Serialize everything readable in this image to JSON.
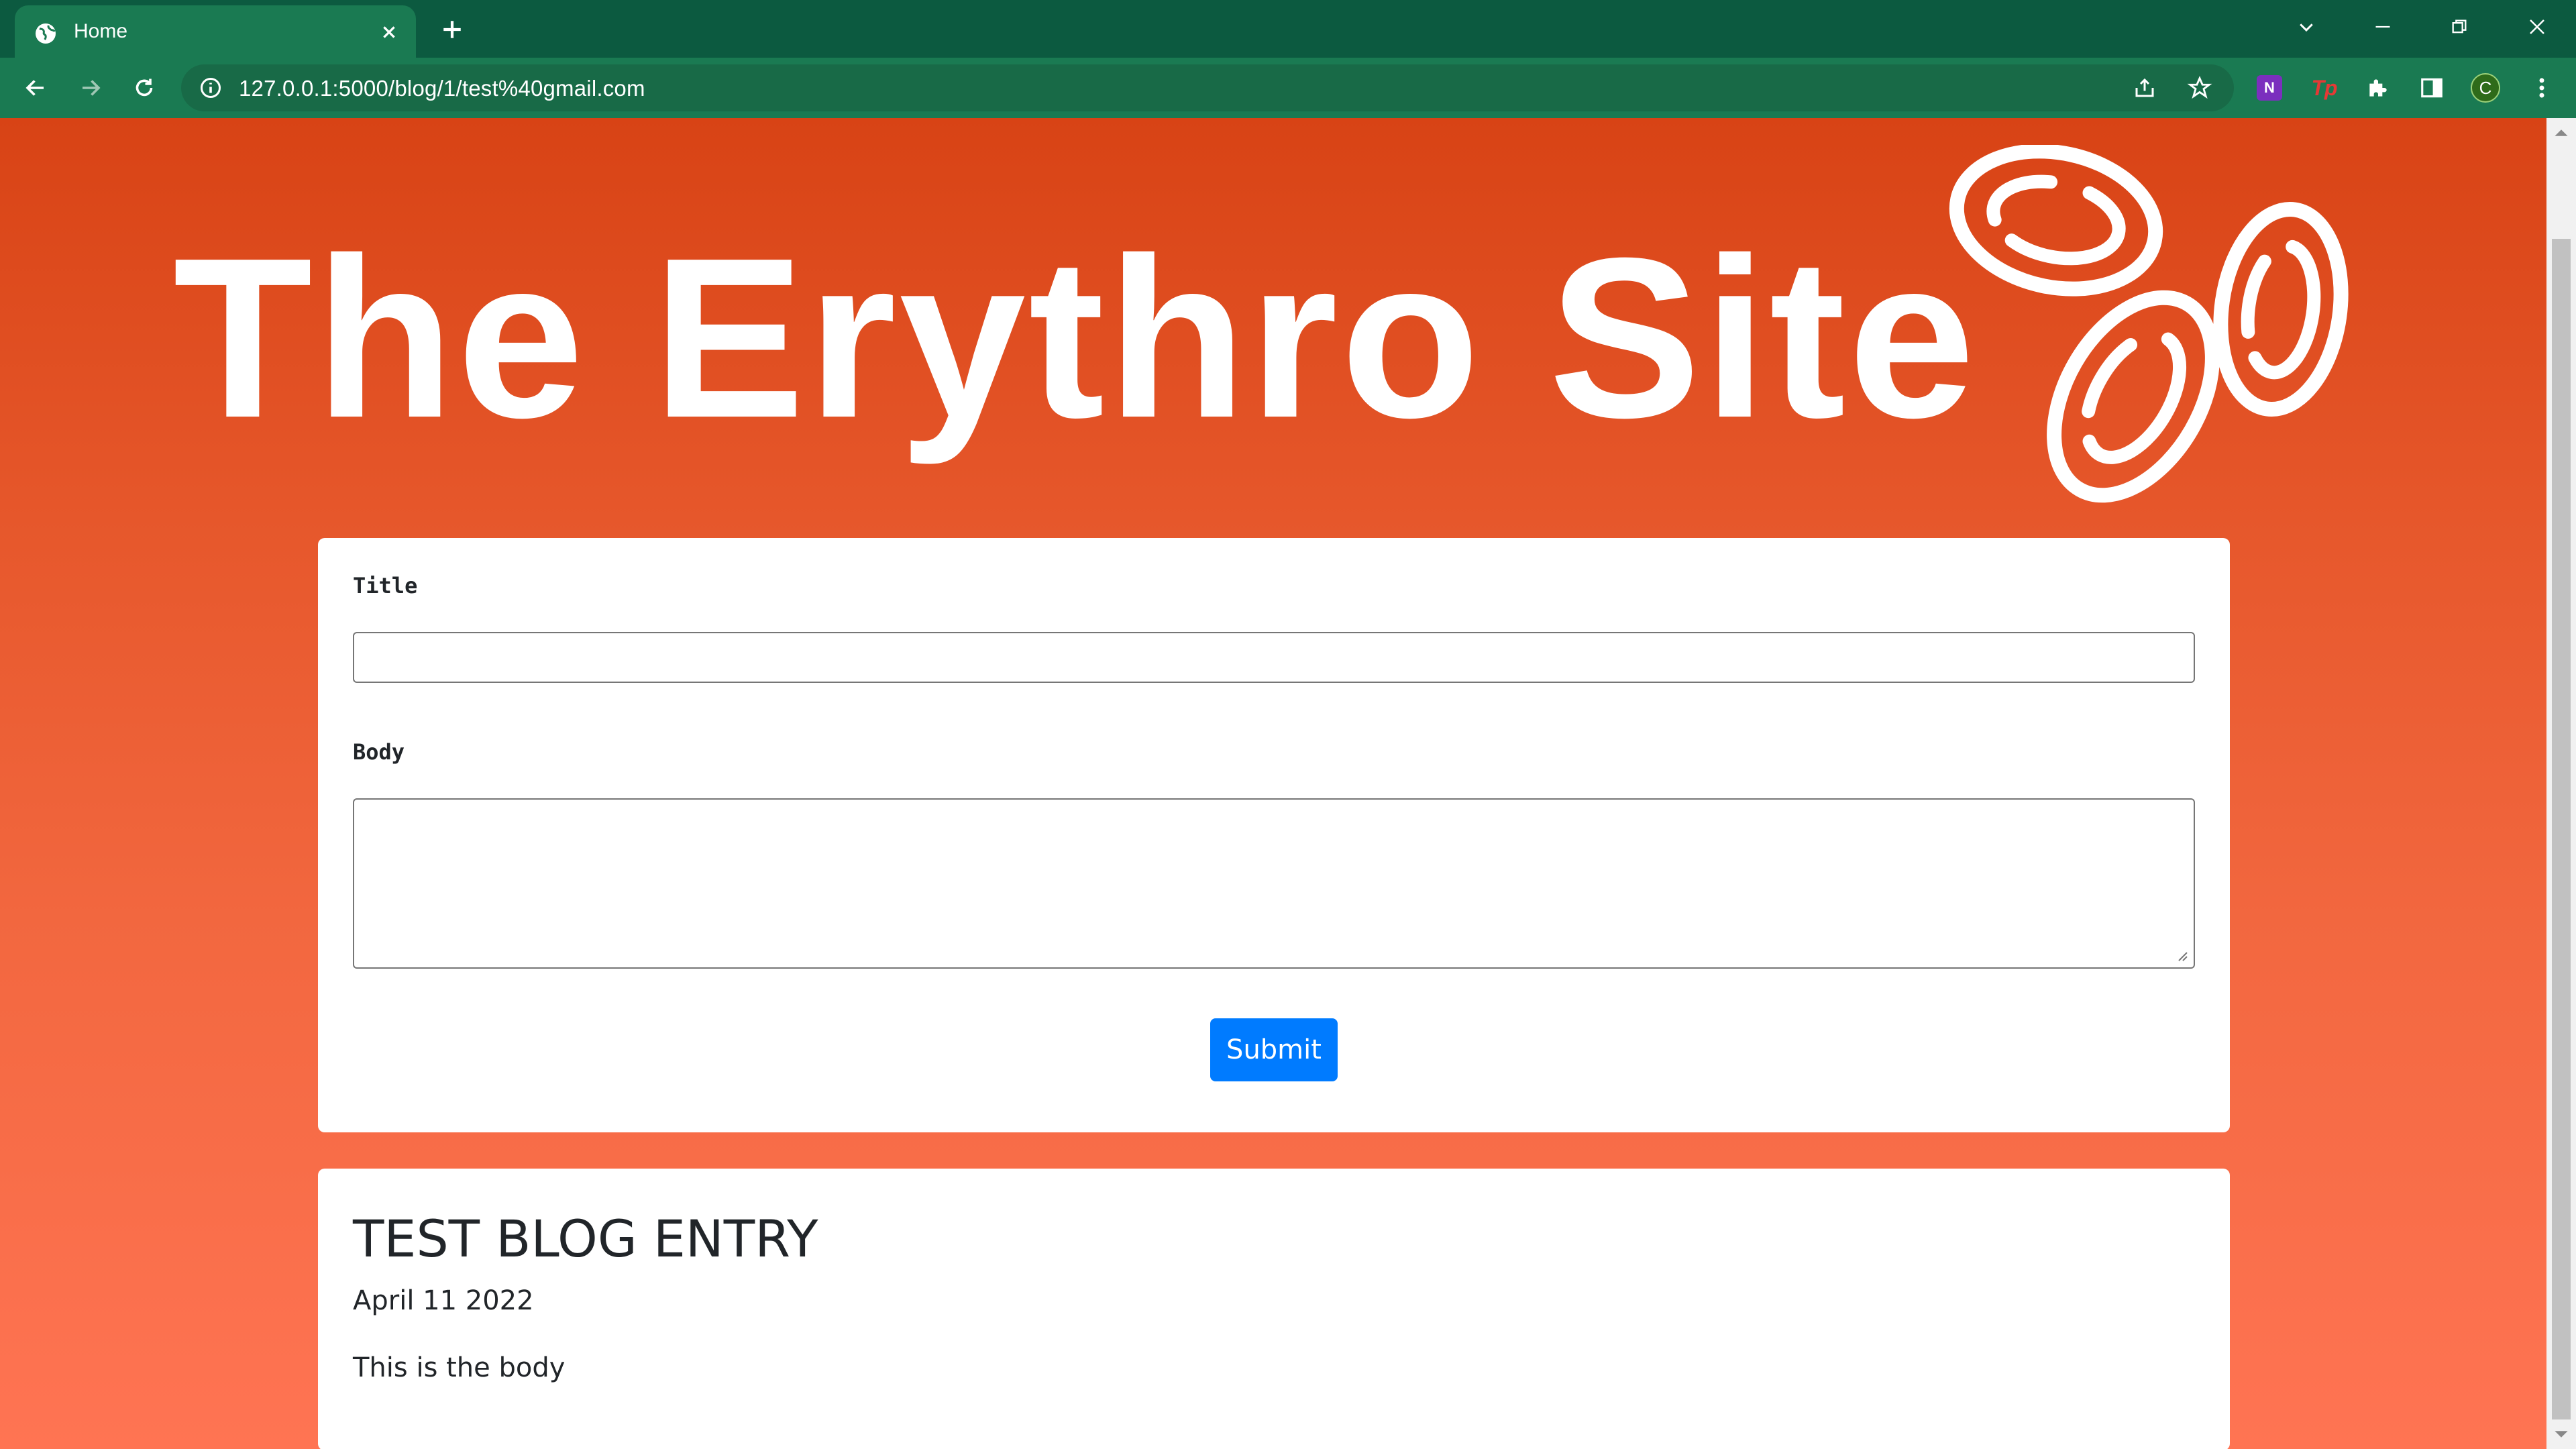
{
  "browser": {
    "tab_title": "Home",
    "url": "127.0.0.1:5000/blog/1/test%40gmail.com",
    "profile_initial": "C",
    "colors": {
      "frame": "#0c5a40",
      "toolbar": "#1a7a52"
    }
  },
  "page": {
    "site_title": "The Erythro Site",
    "logo_icon": "red-blood-cells-icon",
    "colors": {
      "gradient_top": "#d84315",
      "gradient_bottom": "#ff7453",
      "button": "#007bff"
    }
  },
  "form": {
    "title_label": "Title",
    "title_value": "",
    "body_label": "Body",
    "body_value": "",
    "submit_label": "Submit"
  },
  "post": {
    "title": "TEST BLOG ENTRY",
    "date": "April 11 2022",
    "body": "This is the body"
  }
}
